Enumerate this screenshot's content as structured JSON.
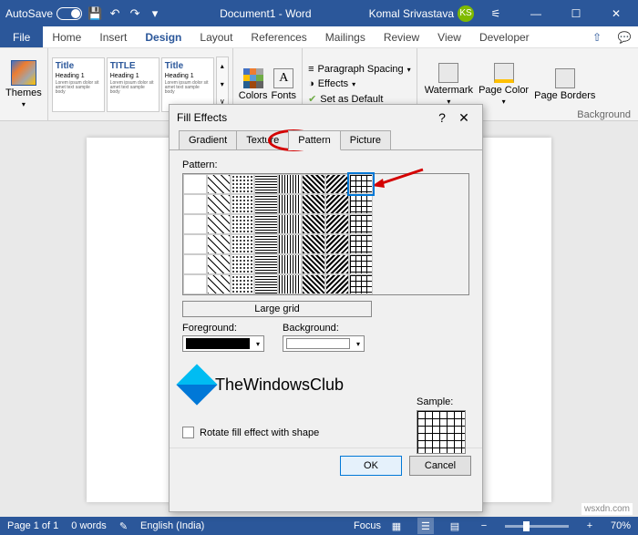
{
  "titlebar": {
    "autosave_label": "AutoSave",
    "doc_title": "Document1 - Word",
    "user_name": "Komal Srivastava",
    "user_initials": "KS"
  },
  "ribbon_tabs": [
    "File",
    "Home",
    "Insert",
    "Design",
    "Layout",
    "References",
    "Mailings",
    "Review",
    "View",
    "Developer"
  ],
  "ribbon": {
    "themes_label": "Themes",
    "style_title": "Title",
    "style_titlecaps": "TITLE",
    "style_heading": "Heading 1",
    "colors_label": "Colors",
    "fonts_label": "Fonts",
    "fonts_glyph": "A",
    "para_spacing": "Paragraph Spacing",
    "effects": "Effects",
    "set_default": "Set as Default",
    "watermark": "Watermark",
    "page_color": "Page Color",
    "page_borders": "Page Borders",
    "group_label": "Background"
  },
  "dialog": {
    "title": "Fill Effects",
    "tabs": [
      "Gradient",
      "Texture",
      "Pattern",
      "Picture"
    ],
    "pattern_label": "Pattern:",
    "selected_pattern": "Large grid",
    "foreground_label": "Foreground:",
    "background_label": "Background:",
    "fg_color": "#000000",
    "bg_color": "#ffffff",
    "sample_label": "Sample:",
    "rotate_label": "Rotate fill effect with shape",
    "ok": "OK",
    "cancel": "Cancel"
  },
  "branding": {
    "text": "TheWindowsClub"
  },
  "statusbar": {
    "page": "Page 1 of 1",
    "words": "0 words",
    "lang": "English (India)",
    "focus": "Focus",
    "zoom": "70%"
  },
  "watermark_site": "wsxdn.com"
}
